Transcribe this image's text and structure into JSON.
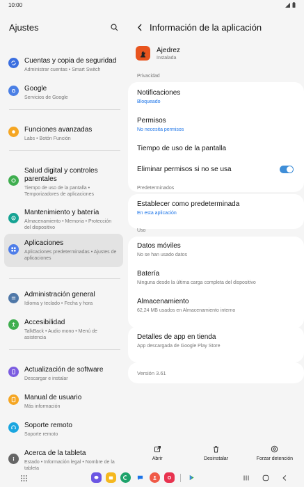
{
  "status_bar": {
    "time": "10:00"
  },
  "left": {
    "title": "Ajustes",
    "items": [
      {
        "title": "Cuentas y copia de seguridad",
        "subtitle": "Administrar cuentas • Smart Switch",
        "icon": "sync-icon",
        "color": "#3b6fe0"
      },
      {
        "title": "Google",
        "subtitle": "Servicios de Google",
        "icon": "google-icon",
        "color": "#4a7fe5"
      },
      {
        "title": "Funciones avanzadas",
        "subtitle": "Labs • Botón Función",
        "icon": "star-gear-icon",
        "color": "#f5a623"
      },
      {
        "title": "Salud digital y controles parentales",
        "subtitle": "Tiempo de uso de la pantalla • Temporizadores de aplicaciones",
        "icon": "wellbeing-icon",
        "color": "#3fae4f"
      },
      {
        "title": "Mantenimiento y batería",
        "subtitle": "Almacenamiento • Memoria • Protección del dispositivo",
        "icon": "maintenance-icon",
        "color": "#15a393"
      },
      {
        "title": "Aplicaciones",
        "subtitle": "Aplicaciones predeterminadas • Ajustes de aplicaciones",
        "icon": "apps-grid-icon",
        "color": "#4e7de9"
      },
      {
        "title": "Administración general",
        "subtitle": "Idioma y teclado • Fecha y hora",
        "icon": "sliders-icon",
        "color": "#4f78a8"
      },
      {
        "title": "Accesibilidad",
        "subtitle": "TalkBack • Audio mono • Menú de asistencia",
        "icon": "accessibility-icon",
        "color": "#3fae4f"
      },
      {
        "title": "Actualización de software",
        "subtitle": "Descargar e instalar",
        "icon": "update-icon",
        "color": "#7b5ce0"
      },
      {
        "title": "Manual de usuario",
        "subtitle": "Más información",
        "icon": "manual-icon",
        "color": "#f5a623"
      },
      {
        "title": "Soporte remoto",
        "subtitle": "Soporte remoto",
        "icon": "headset-icon",
        "color": "#1aa6e0"
      },
      {
        "title": "Acerca de la tableta",
        "subtitle": "Estado • Información legal • Nombre de la tableta",
        "icon": "info-icon",
        "color": "#666666"
      }
    ]
  },
  "right": {
    "title": "Información de la aplicación",
    "app": {
      "name": "Ajedrez",
      "status": "Instalada"
    },
    "sections": {
      "privacy": "Privacidad",
      "defaults": "Predeterminados",
      "usage": "Uso"
    },
    "notifications": {
      "title": "Notificaciones",
      "subtitle": "Bloqueado"
    },
    "permissions": {
      "title": "Permisos",
      "subtitle": "No necesita permisos"
    },
    "screen_time": {
      "title": "Tiempo de uso de la pantalla"
    },
    "remove_permissions": {
      "title": "Eliminar permisos si no se usa",
      "enabled": true
    },
    "set_default": {
      "title": "Establecer como predeterminada",
      "subtitle": "En esta aplicación"
    },
    "mobile_data": {
      "title": "Datos móviles",
      "subtitle": "No se han usado datos"
    },
    "battery": {
      "title": "Batería",
      "subtitle": "Ninguna desde la última carga completa del dispositivo"
    },
    "storage": {
      "title": "Almacenamiento",
      "subtitle": "62,24 MB usados en Almacenamiento interno"
    },
    "store": {
      "title": "Detalles de app en tienda",
      "subtitle": "App descargada de Google Play Store"
    },
    "version": "Versión 3.61"
  },
  "actions": {
    "open": "Abrir",
    "uninstall": "Desinstalar",
    "force_stop": "Forzar detención"
  },
  "colors": {
    "accent": "#1a73e8",
    "toggle": "#3f8ed8",
    "background": "#f5f5f5",
    "card": "#ffffff"
  }
}
